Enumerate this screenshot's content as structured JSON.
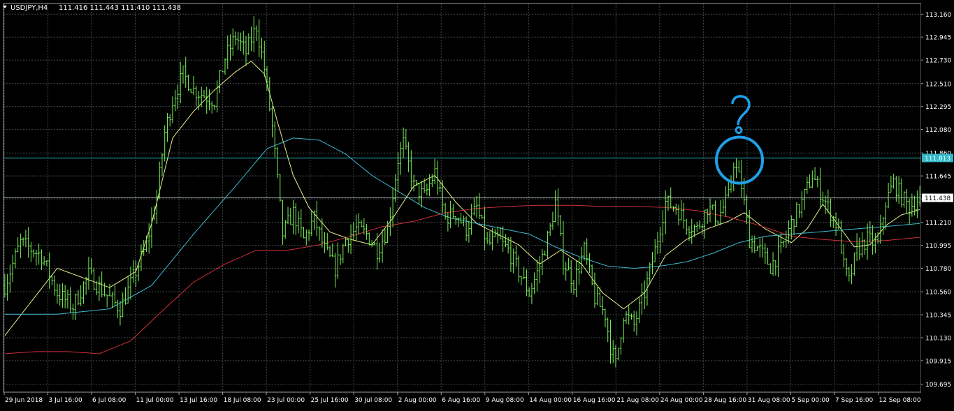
{
  "header": {
    "symbol_text": "USDJPY,H4",
    "ohlc_text": "111.416 111.443 111.410 111.438"
  },
  "colors": {
    "background": "#000000",
    "grid": "#3e4a4a",
    "candle": "#7cf05a",
    "ma_fast": "#e8f08c",
    "ma_mid": "#3fb8d0",
    "ma_slow": "#d0303a",
    "hline": "#2fb8c8",
    "annotation": "#1fa0e8",
    "axis_text": "#ffffff"
  },
  "chart_data": {
    "type": "line",
    "ylim": [
      109.62,
      113.26
    ],
    "y_ticks": [
      "113.160",
      "112.945",
      "112.730",
      "112.510",
      "112.295",
      "112.080",
      "111.860",
      "111.645",
      "111.430",
      "111.210",
      "110.995",
      "110.780",
      "110.560",
      "110.345",
      "110.130",
      "109.915",
      "109.695"
    ],
    "x_labels": [
      "29 Jun 2018",
      "3 Jul 16:00",
      "6 Jul 08:00",
      "11 Jul 00:00",
      "13 Jul 16:00",
      "18 Jul 08:00",
      "23 Jul 00:00",
      "25 Jul 16:00",
      "30 Jul 08:00",
      "2 Aug 00:00",
      "6 Aug 16:00",
      "9 Aug 08:00",
      "14 Aug 00:00",
      "16 Aug 16:00",
      "21 Aug 08:00",
      "24 Aug 00:00",
      "28 Aug 16:00",
      "31 Aug 08:00",
      "5 Sep 00:00",
      "7 Sep 16:00",
      "12 Sep 08:00"
    ],
    "price_anchors": [
      [
        0,
        110.62
      ],
      [
        6,
        111.02
      ],
      [
        14,
        110.9
      ],
      [
        20,
        110.55
      ],
      [
        26,
        110.42
      ],
      [
        32,
        110.72
      ],
      [
        38,
        110.55
      ],
      [
        44,
        110.4
      ],
      [
        50,
        110.75
      ],
      [
        54,
        111.0
      ],
      [
        58,
        111.45
      ],
      [
        61,
        112.05
      ],
      [
        64,
        112.35
      ],
      [
        68,
        112.6
      ],
      [
        72,
        112.45
      ],
      [
        76,
        112.4
      ],
      [
        80,
        112.35
      ],
      [
        84,
        112.75
      ],
      [
        88,
        112.95
      ],
      [
        92,
        112.8
      ],
      [
        96,
        113.05
      ],
      [
        99,
        112.65
      ],
      [
        102,
        112.1
      ],
      [
        106,
        111.1
      ],
      [
        110,
        111.3
      ],
      [
        114,
        111.05
      ],
      [
        118,
        111.25
      ],
      [
        122,
        110.95
      ],
      [
        126,
        110.78
      ],
      [
        130,
        111.05
      ],
      [
        134,
        111.15
      ],
      [
        138,
        111.1
      ],
      [
        142,
        110.95
      ],
      [
        146,
        111.15
      ],
      [
        150,
        111.8
      ],
      [
        152,
        111.95
      ],
      [
        156,
        111.55
      ],
      [
        160,
        111.45
      ],
      [
        164,
        111.68
      ],
      [
        168,
        111.25
      ],
      [
        172,
        111.3
      ],
      [
        176,
        111.15
      ],
      [
        180,
        111.35
      ],
      [
        184,
        111.0
      ],
      [
        188,
        111.05
      ],
      [
        192,
        110.95
      ],
      [
        196,
        110.75
      ],
      [
        200,
        110.55
      ],
      [
        204,
        110.8
      ],
      [
        208,
        111.15
      ],
      [
        210,
        111.4
      ],
      [
        213,
        110.85
      ],
      [
        217,
        110.65
      ],
      [
        221,
        110.95
      ],
      [
        225,
        110.5
      ],
      [
        229,
        110.35
      ],
      [
        231,
        110.05
      ],
      [
        233,
        109.88
      ],
      [
        236,
        110.35
      ],
      [
        240,
        110.25
      ],
      [
        244,
        110.55
      ],
      [
        248,
        110.95
      ],
      [
        252,
        111.4
      ],
      [
        256,
        111.35
      ],
      [
        260,
        111.2
      ],
      [
        264,
        111.15
      ],
      [
        268,
        111.35
      ],
      [
        272,
        111.25
      ],
      [
        276,
        111.45
      ],
      [
        278,
        111.78
      ],
      [
        281,
        111.55
      ],
      [
        284,
        111.05
      ],
      [
        288,
        110.95
      ],
      [
        292,
        110.8
      ],
      [
        296,
        110.95
      ],
      [
        300,
        111.2
      ],
      [
        304,
        111.4
      ],
      [
        308,
        111.65
      ],
      [
        311,
        111.5
      ],
      [
        314,
        111.35
      ],
      [
        318,
        111.15
      ],
      [
        320,
        110.8
      ],
      [
        322,
        110.65
      ],
      [
        325,
        110.95
      ],
      [
        329,
        111.05
      ],
      [
        333,
        111.0
      ],
      [
        336,
        111.4
      ],
      [
        339,
        111.58
      ],
      [
        342,
        111.45
      ],
      [
        345,
        111.35
      ],
      [
        347,
        111.4
      ],
      [
        349,
        111.44
      ]
    ],
    "ma_fast_anchors": [
      [
        0,
        110.15
      ],
      [
        20,
        110.78
      ],
      [
        40,
        110.6
      ],
      [
        50,
        110.75
      ],
      [
        56,
        111.2
      ],
      [
        64,
        112.0
      ],
      [
        72,
        112.25
      ],
      [
        80,
        112.45
      ],
      [
        88,
        112.62
      ],
      [
        94,
        112.72
      ],
      [
        99,
        112.6
      ],
      [
        104,
        112.15
      ],
      [
        110,
        111.65
      ],
      [
        116,
        111.35
      ],
      [
        124,
        111.12
      ],
      [
        132,
        111.05
      ],
      [
        140,
        111.0
      ],
      [
        148,
        111.25
      ],
      [
        156,
        111.55
      ],
      [
        164,
        111.65
      ],
      [
        172,
        111.4
      ],
      [
        180,
        111.2
      ],
      [
        188,
        111.1
      ],
      [
        196,
        111.0
      ],
      [
        204,
        110.82
      ],
      [
        212,
        110.95
      ],
      [
        220,
        110.82
      ],
      [
        228,
        110.55
      ],
      [
        236,
        110.4
      ],
      [
        244,
        110.55
      ],
      [
        252,
        110.9
      ],
      [
        260,
        111.05
      ],
      [
        268,
        111.15
      ],
      [
        276,
        111.22
      ],
      [
        282,
        111.3
      ],
      [
        290,
        111.15
      ],
      [
        300,
        111.02
      ],
      [
        306,
        111.15
      ],
      [
        312,
        111.38
      ],
      [
        318,
        111.18
      ],
      [
        324,
        110.98
      ],
      [
        330,
        111.0
      ],
      [
        336,
        111.18
      ],
      [
        342,
        111.28
      ],
      [
        349,
        111.33
      ]
    ],
    "ma_mid_anchors": [
      [
        0,
        110.35
      ],
      [
        20,
        110.35
      ],
      [
        40,
        110.4
      ],
      [
        56,
        110.62
      ],
      [
        72,
        111.1
      ],
      [
        88,
        111.55
      ],
      [
        100,
        111.9
      ],
      [
        110,
        112.0
      ],
      [
        120,
        111.98
      ],
      [
        130,
        111.85
      ],
      [
        140,
        111.65
      ],
      [
        150,
        111.5
      ],
      [
        160,
        111.35
      ],
      [
        170,
        111.25
      ],
      [
        180,
        111.2
      ],
      [
        190,
        111.15
      ],
      [
        200,
        111.1
      ],
      [
        210,
        110.98
      ],
      [
        220,
        110.88
      ],
      [
        230,
        110.8
      ],
      [
        240,
        110.78
      ],
      [
        250,
        110.8
      ],
      [
        260,
        110.84
      ],
      [
        270,
        110.92
      ],
      [
        280,
        111.02
      ],
      [
        290,
        111.08
      ],
      [
        300,
        111.1
      ],
      [
        310,
        111.12
      ],
      [
        320,
        111.14
      ],
      [
        330,
        111.16
      ],
      [
        340,
        111.18
      ],
      [
        349,
        111.2
      ]
    ],
    "ma_slow_anchors": [
      [
        0,
        109.98
      ],
      [
        12,
        110.0
      ],
      [
        24,
        110.0
      ],
      [
        36,
        109.98
      ],
      [
        48,
        110.1
      ],
      [
        60,
        110.38
      ],
      [
        72,
        110.65
      ],
      [
        84,
        110.82
      ],
      [
        96,
        110.95
      ],
      [
        108,
        110.95
      ],
      [
        120,
        111.0
      ],
      [
        132,
        111.08
      ],
      [
        144,
        111.17
      ],
      [
        156,
        111.22
      ],
      [
        168,
        111.3
      ],
      [
        180,
        111.34
      ],
      [
        192,
        111.36
      ],
      [
        204,
        111.37
      ],
      [
        216,
        111.37
      ],
      [
        228,
        111.36
      ],
      [
        240,
        111.36
      ],
      [
        252,
        111.35
      ],
      [
        264,
        111.32
      ],
      [
        276,
        111.26
      ],
      [
        288,
        111.18
      ],
      [
        300,
        111.08
      ],
      [
        312,
        111.05
      ],
      [
        324,
        111.03
      ],
      [
        336,
        111.04
      ],
      [
        349,
        111.07
      ]
    ],
    "horizontal_line_value": 111.813,
    "price_tags": [
      {
        "label": "111.813",
        "kind": "hline"
      },
      {
        "label": "111.438",
        "kind": "current"
      }
    ],
    "annotation": {
      "text": "?",
      "anchor_index": 281,
      "anchor_value": 111.78
    }
  }
}
